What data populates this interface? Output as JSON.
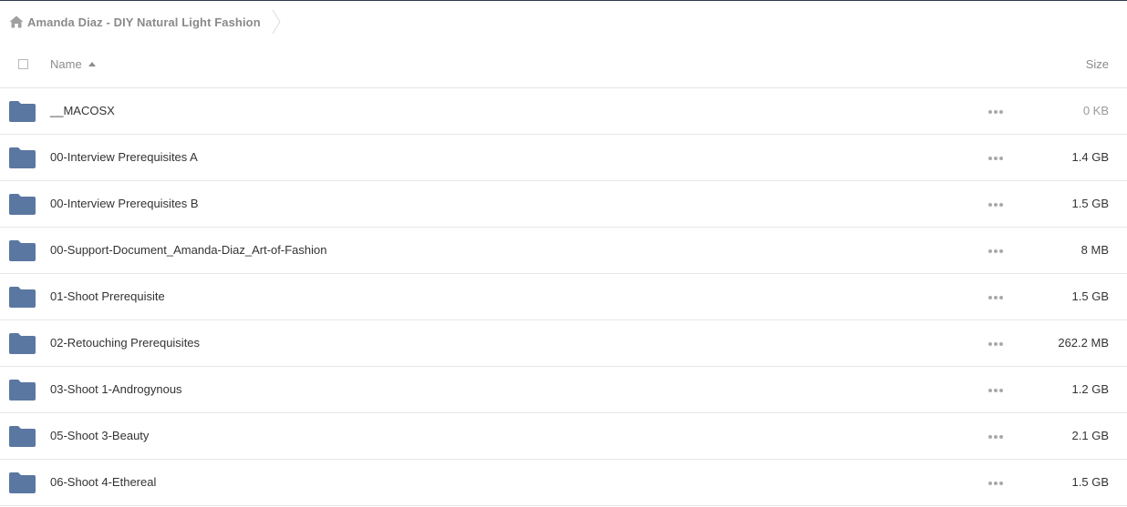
{
  "breadcrumb": {
    "home_icon": "home-icon",
    "label": "Amanda Diaz - DIY Natural Light Fashion"
  },
  "header": {
    "name_label": "Name",
    "size_label": "Size",
    "sort": "ascending"
  },
  "colors": {
    "folder": "#5a77a1",
    "separator": "#e6e6e6",
    "top_border": "#2b3a4a"
  },
  "rows": [
    {
      "name": "__MACOSX",
      "size": "0 KB",
      "icon": "folder-icon"
    },
    {
      "name": "00-Interview Prerequisites A",
      "size": "1.4 GB",
      "icon": "folder-icon"
    },
    {
      "name": "00-Interview Prerequisites B",
      "size": "1.5 GB",
      "icon": "folder-icon"
    },
    {
      "name": "00-Support-Document_Amanda-Diaz_Art-of-Fashion",
      "size": "8 MB",
      "icon": "folder-icon"
    },
    {
      "name": "01-Shoot Prerequisite",
      "size": "1.5 GB",
      "icon": "folder-icon"
    },
    {
      "name": "02-Retouching Prerequisites",
      "size": "262.2 MB",
      "icon": "folder-icon"
    },
    {
      "name": "03-Shoot 1-Androgynous",
      "size": "1.2 GB",
      "icon": "folder-icon"
    },
    {
      "name": "05-Shoot 3-Beauty",
      "size": "2.1 GB",
      "icon": "folder-icon"
    },
    {
      "name": "06-Shoot 4-Ethereal",
      "size": "1.5 GB",
      "icon": "folder-icon"
    }
  ]
}
